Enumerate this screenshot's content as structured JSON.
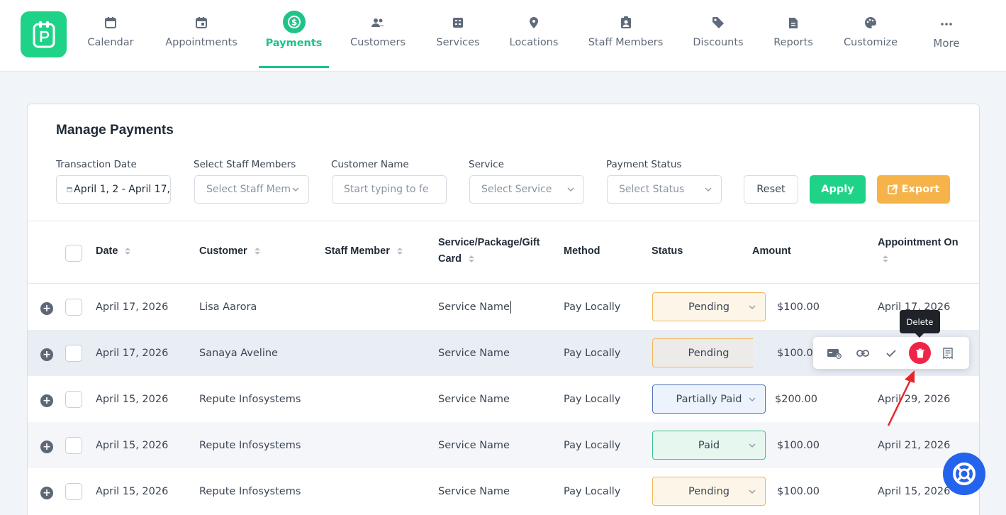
{
  "nav": {
    "items": [
      {
        "label": "Calendar",
        "icon": "calendar-icon"
      },
      {
        "label": "Appointments",
        "icon": "calendar-check-icon"
      },
      {
        "label": "Payments",
        "icon": "dollar-icon",
        "active": true
      },
      {
        "label": "Customers",
        "icon": "users-icon"
      },
      {
        "label": "Services",
        "icon": "services-icon"
      },
      {
        "label": "Locations",
        "icon": "map-pin-icon"
      },
      {
        "label": "Staff Members",
        "icon": "id-badge-icon"
      },
      {
        "label": "Discounts",
        "icon": "tag-icon"
      },
      {
        "label": "Reports",
        "icon": "report-icon"
      },
      {
        "label": "Customize",
        "icon": "palette-icon"
      },
      {
        "label": "More",
        "icon": "ellipsis-icon"
      }
    ]
  },
  "page": {
    "title": "Manage Payments"
  },
  "filters": {
    "transaction_date": {
      "label": "Transaction Date",
      "value": "April 1, 2 - April 17,"
    },
    "staff": {
      "label": "Select Staff Members",
      "placeholder": "Select Staff Mem"
    },
    "customer": {
      "label": "Customer Name",
      "placeholder": "Start typing to fe"
    },
    "service": {
      "label": "Service",
      "placeholder": "Select Service"
    },
    "status": {
      "label": "Payment Status",
      "placeholder": "Select Status"
    },
    "reset_label": "Reset",
    "apply_label": "Apply",
    "export_label": "Export"
  },
  "table": {
    "headers": {
      "date": "Date",
      "customer": "Customer",
      "staff": "Staff Member",
      "service_line1": "Service/Package/Gift",
      "service_line2": "Card",
      "method": "Method",
      "status": "Status",
      "amount": "Amount",
      "appointment": "Appointment On"
    },
    "rows": [
      {
        "date": "April 17, 2026",
        "customer": "Lisa Aarora",
        "service": "Service Name",
        "method": "Pay Locally",
        "status": "Pending",
        "amount": "$100.00",
        "appointment": "April 17, 2026"
      },
      {
        "date": "April 17, 2026",
        "customer": "Sanaya Aveline",
        "service": "Service Name",
        "method": "Pay Locally",
        "status": "Pending",
        "amount": "$100.00",
        "appointment": ""
      },
      {
        "date": "April 15, 2026",
        "customer": "Repute Infosystems",
        "service": "Service Name",
        "method": "Pay Locally",
        "status": "Partially Paid",
        "amount": "$200.00",
        "appointment": "April 29, 2026"
      },
      {
        "date": "April 15, 2026",
        "customer": "Repute Infosystems",
        "service": "Service Name",
        "method": "Pay Locally",
        "status": "Paid",
        "amount": "$100.00",
        "appointment": "April 21, 2026"
      },
      {
        "date": "April 15, 2026",
        "customer": "Repute Infosystems",
        "service": "Service Name",
        "method": "Pay Locally",
        "status": "Pending",
        "amount": "$100.00",
        "appointment": "April 15, 2026"
      }
    ]
  },
  "actions": {
    "tooltip": "Delete"
  },
  "colors": {
    "accent": "#1ed387",
    "export": "#f5b34a",
    "delete": "#ef2448",
    "help": "#2463eb"
  }
}
